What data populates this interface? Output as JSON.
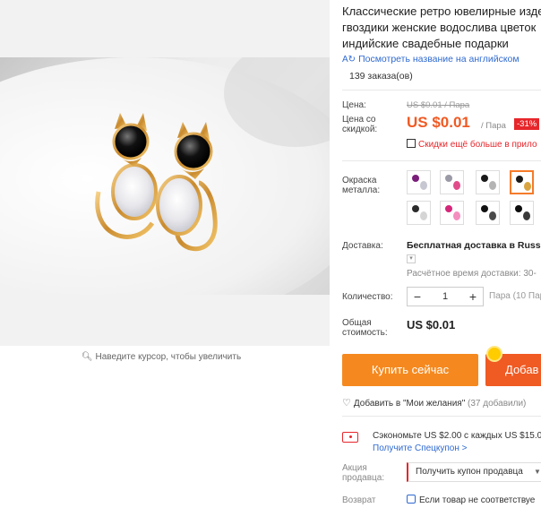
{
  "gallery": {
    "zoom_hint": "Наведите курсор, чтобы увеличить"
  },
  "product": {
    "title_line1": "Классические ретро ювелирные изде",
    "title_line2": "гвоздики женские водослива цветок",
    "title_line3": "индийские свадебные подарки",
    "translate_link": "Посмотреть название на английском",
    "orders": "139 заказа(ов)"
  },
  "price": {
    "label": "Цена:",
    "old": "US $0.01 / Пара",
    "discount_label": "Цена со скидкой:",
    "new": "US $0.01",
    "per": "/ Пара",
    "badge": "-31%",
    "promo": "Скидки ещё больше в прило"
  },
  "options": {
    "metal_label": "Окраска металла:",
    "swatches": [
      {
        "name": "swatch-1",
        "colors": [
          "#7a1e7a",
          "#c7c7d2"
        ]
      },
      {
        "name": "swatch-2",
        "colors": [
          "#9a9aa6",
          "#e04d8a"
        ]
      },
      {
        "name": "swatch-3",
        "colors": [
          "#1a1a1a",
          "#b4b4b4"
        ]
      },
      {
        "name": "swatch-4",
        "colors": [
          "#1a1a1a",
          "#d9a441"
        ],
        "selected": true
      },
      {
        "name": "swatch-5",
        "colors": [
          "#2b2b2b",
          "#d5d5d5"
        ]
      },
      {
        "name": "swatch-6",
        "colors": [
          "#d4267a",
          "#f48fbf"
        ]
      },
      {
        "name": "swatch-7",
        "colors": [
          "#111111",
          "#4a4a4a"
        ]
      },
      {
        "name": "swatch-8",
        "colors": [
          "#0d0d0d",
          "#3a3a3a"
        ]
      }
    ]
  },
  "shipping": {
    "label": "Доставка:",
    "value": "Бесплатная доставка в Russia",
    "time": "Расчётное время доставки: 30-"
  },
  "quantity": {
    "label": "Количество:",
    "minus": "−",
    "value": "1",
    "plus": "+",
    "unit": "Пара (10 Пар"
  },
  "total": {
    "label": "Общая стоимость:",
    "value": "US $0.01"
  },
  "actions": {
    "buy_now": "Купить сейчас",
    "add_to_cart": "Добав"
  },
  "wishlist": {
    "label": "Добавить в \"Мои желания\"",
    "count": "(37 добавили)"
  },
  "coupon": {
    "save_text": "Сэкономьте US $2.00 с каждых US $15.0",
    "get_link": "Получите Спецкупон >"
  },
  "seller": {
    "label": "Акция продавца:",
    "select_value": "Получить купон продавца"
  },
  "returns": {
    "label": "Возврат",
    "text": "Если товар не соответствуе"
  },
  "colors": {
    "accent_orange": "#f5891f",
    "accent_red": "#f05a23",
    "badge_red": "#e6262b",
    "link_blue": "#2f6ad0"
  }
}
